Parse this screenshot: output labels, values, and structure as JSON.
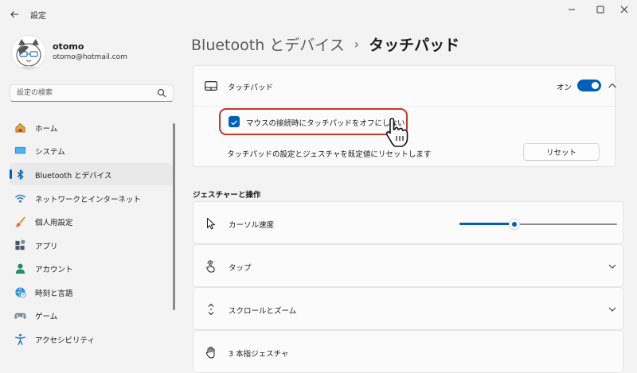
{
  "window": {
    "title": "設定"
  },
  "profile": {
    "name": "otomo",
    "email": "otomo@hotmail.com"
  },
  "search": {
    "placeholder": "設定の検索"
  },
  "sidebar": {
    "items": [
      {
        "label": "ホーム",
        "icon": "home-icon"
      },
      {
        "label": "システム",
        "icon": "system-icon"
      },
      {
        "label": "Bluetooth とデバイス",
        "icon": "bluetooth-icon",
        "selected": true
      },
      {
        "label": "ネットワークとインターネット",
        "icon": "wifi-icon"
      },
      {
        "label": "個人用設定",
        "icon": "brush-icon"
      },
      {
        "label": "アプリ",
        "icon": "apps-icon"
      },
      {
        "label": "アカウント",
        "icon": "account-icon"
      },
      {
        "label": "時刻と言語",
        "icon": "globe-clock-icon"
      },
      {
        "label": "ゲーム",
        "icon": "gamepad-icon"
      },
      {
        "label": "アクセシビリティ",
        "icon": "accessibility-icon"
      }
    ]
  },
  "header": {
    "parent": "Bluetooth とデバイス",
    "separator": "›",
    "current": "タッチパッド"
  },
  "touchpad": {
    "title": "タッチパッド",
    "toggle_state": "オン",
    "toggle_on": true,
    "checkbox_label": "マウスの接続時にタッチパッドをオフにしない",
    "checkbox_checked": true,
    "reset_description": "タッチパッドの設定とジェスチャを既定値にリセットします",
    "reset_button": "リセット"
  },
  "gestures": {
    "section_title": "ジェスチャーと操作",
    "cursor_speed_label": "カーソル速度",
    "cursor_speed_value": 0.35,
    "tap_label": "タップ",
    "scroll_label": "スクロールとズーム",
    "three_finger_label": "3 本指ジェスチャ"
  },
  "colors": {
    "accent": "#005fb8",
    "highlight": "#c0392b"
  }
}
